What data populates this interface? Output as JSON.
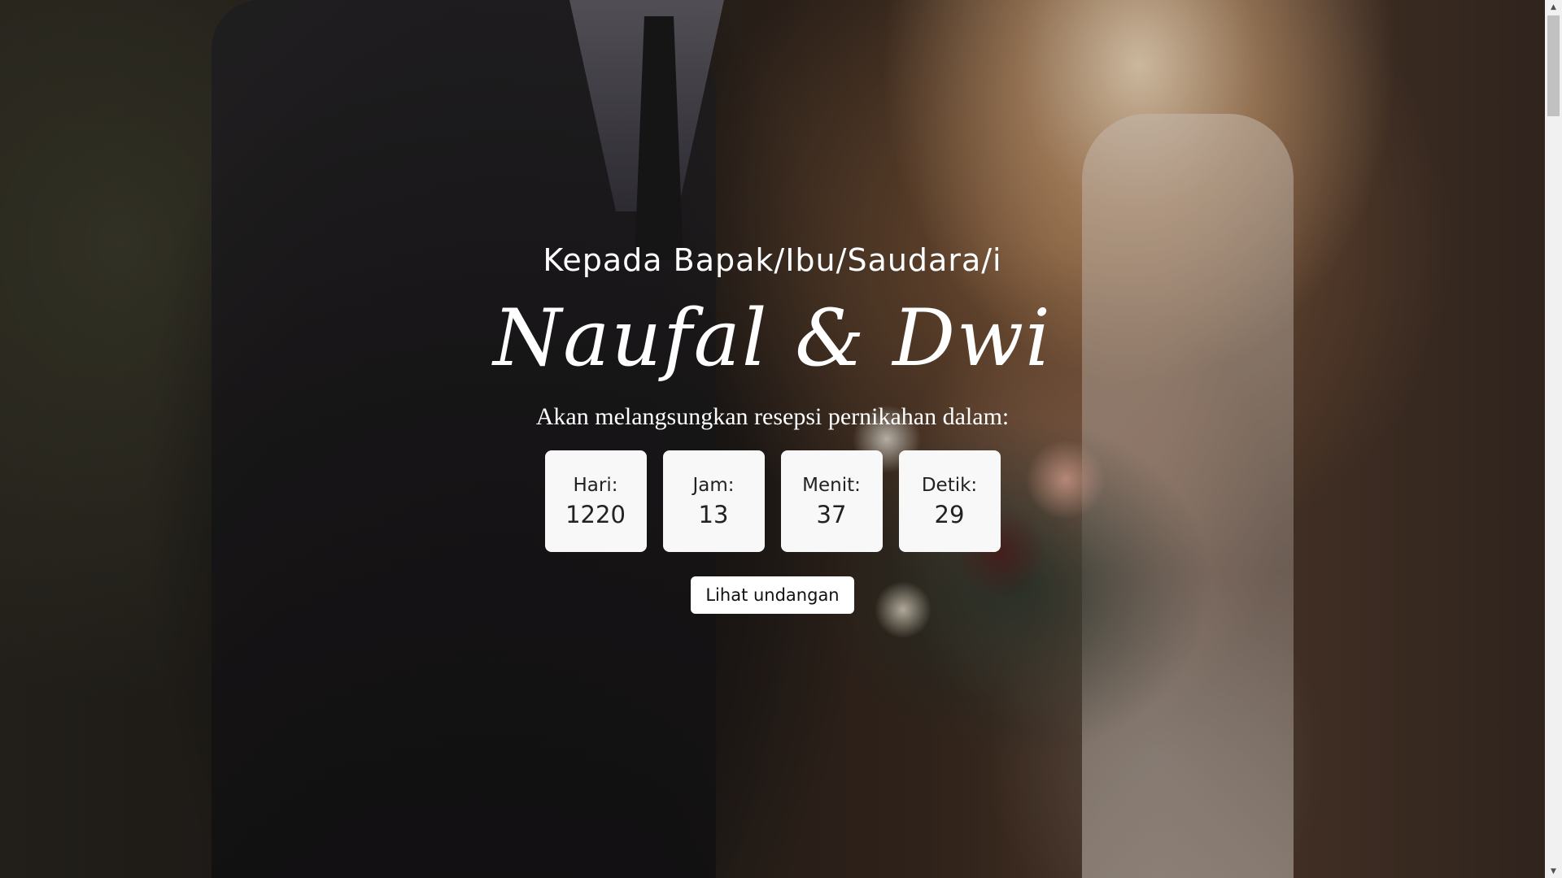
{
  "hero": {
    "greeting": "Kepada Bapak/Ibu/Saudara/i",
    "couple_names": "Naufal & Dwi",
    "countdown_intro": "Akan melangsungkan resepsi pernikahan dalam:"
  },
  "countdown": {
    "days": {
      "label": "Hari:",
      "value": "1220"
    },
    "hours": {
      "label": "Jam:",
      "value": "13"
    },
    "minutes": {
      "label": "Menit:",
      "value": "37"
    },
    "seconds": {
      "label": "Detik:",
      "value": "29"
    }
  },
  "actions": {
    "open_invitation_label": "Lihat undangan"
  },
  "scrollbar": {
    "up_icon": "chevron-up-icon",
    "down_icon": "chevron-down-icon"
  },
  "colors": {
    "text": "#ffffff",
    "box_bg": "#f8f8f8",
    "button_bg": "#ffffff"
  }
}
